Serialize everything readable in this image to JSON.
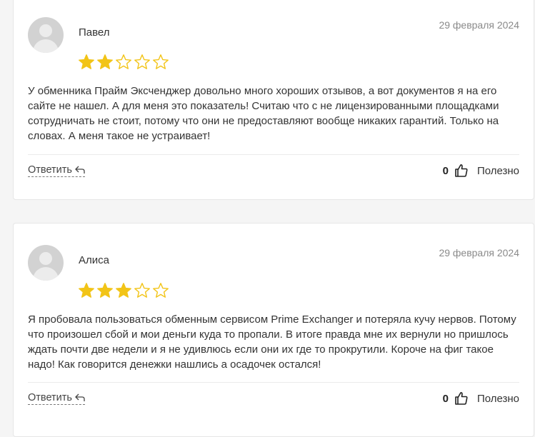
{
  "reviews": [
    {
      "author": "Павел",
      "date": "29 февраля 2024",
      "rating": 2,
      "max_rating": 5,
      "text": "У обменника Прайм Эксченджер довольно много хороших отзывов, а вот документов я на его сайте не нашел. А для меня это показатель! Считаю что с не лицензированными площадками сотрудничать не стоит, потому что они не предоставляют вообще никаких гарантий. Только на словах. А меня такое не устраивает!",
      "reply_label": "Ответить",
      "likes": "0",
      "useful_label": "Полезно"
    },
    {
      "author": "Алиса",
      "date": "29 февраля 2024",
      "rating": 3,
      "max_rating": 5,
      "text": "Я пробовала пользоваться обменным сервисом Prime Exchanger и потеряла кучу нервов. Потому что произошел сбой и мои деньги куда то пропали. В итоге правда мне их вернули но пришлось ждать почти две недели и я не удивлюсь если они их где то прокрутили. Короче на фиг такое надо! Как говорится денежки нашлись а осадочек остался!",
      "reply_label": "Ответить",
      "likes": "0",
      "useful_label": "Полезно"
    }
  ],
  "colors": {
    "star_filled": "#f2c417",
    "star_empty_stroke": "#f2c417",
    "background": "#f5f5f5",
    "card": "#ffffff"
  }
}
